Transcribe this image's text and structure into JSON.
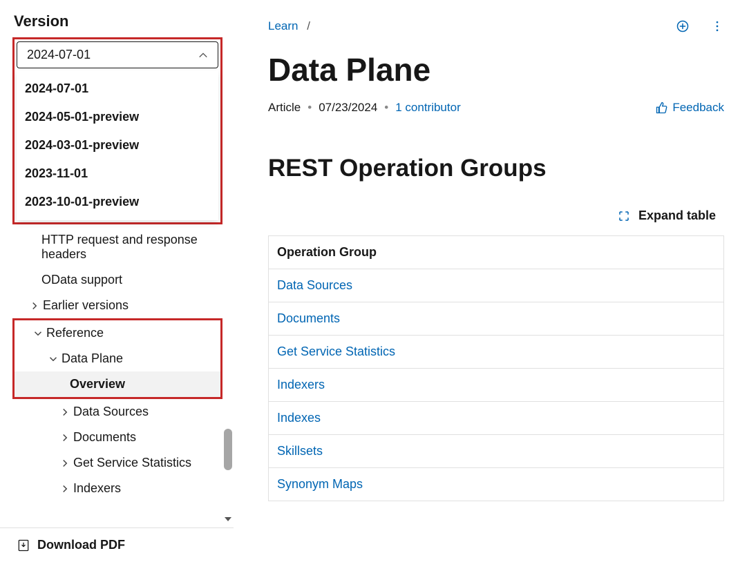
{
  "sidebar": {
    "version_label": "Version",
    "selected_version": "2024-07-01",
    "options": [
      "2024-07-01",
      "2024-05-01-preview",
      "2024-03-01-preview",
      "2023-11-01",
      "2023-10-01-preview"
    ],
    "nav": {
      "http_headers": "HTTP request and response headers",
      "odata": "OData support",
      "earlier": "Earlier versions",
      "reference": "Reference",
      "data_plane": "Data Plane",
      "overview": "Overview",
      "children": [
        "Data Sources",
        "Documents",
        "Get Service Statistics",
        "Indexers"
      ]
    },
    "download_pdf": "Download PDF"
  },
  "breadcrumb": {
    "learn": "Learn",
    "sep": "/"
  },
  "actions": {
    "add": "add",
    "more": "more"
  },
  "page": {
    "title": "Data Plane",
    "type": "Article",
    "date": "07/23/2024",
    "contributor": "1 contributor",
    "feedback": "Feedback",
    "section": "REST Operation Groups",
    "expand": "Expand table",
    "table_header": "Operation Group",
    "rows": [
      "Data Sources",
      "Documents",
      "Get Service Statistics",
      "Indexers",
      "Indexes",
      "Skillsets",
      "Synonym Maps"
    ]
  }
}
